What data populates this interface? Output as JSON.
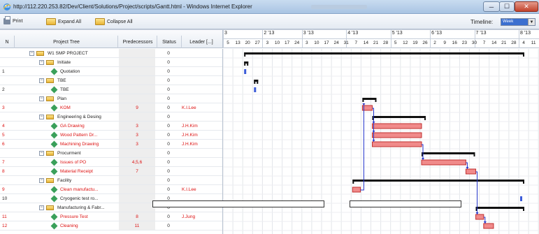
{
  "window": {
    "title": "http://112.220.253.82/Dev/Client/Solutions/Project/scripts/Gantt.html - Windows Internet Explorer",
    "minimize": "─",
    "maximize": "☐",
    "close": "✕"
  },
  "toolbar": {
    "print_label": "Print",
    "expand_label": "Expand All",
    "collapse_label": "Collapse All",
    "timeline_label": "Timeline:",
    "timeline_value": "Week",
    "timeline_arrow": "▼"
  },
  "columns": {
    "n": "N",
    "tree": "Project Tree",
    "pred": "Predecessors",
    "status": "Status",
    "leader": "Leader [...]"
  },
  "timeline": {
    "months": [
      "3",
      "2 '13",
      "3 '13",
      "4 '13",
      "5 '13",
      "6 '13",
      "7 '13",
      "8 '13"
    ],
    "weeks": [
      "5",
      "13",
      "20",
      "27",
      "3",
      "10",
      "17",
      "24",
      "3",
      "10",
      "17",
      "24",
      "31",
      "7",
      "14",
      "21",
      "28",
      "5",
      "12",
      "19",
      "26",
      "2",
      "9",
      "16",
      "23",
      "30",
      "7",
      "14",
      "21",
      "28",
      "4",
      "11"
    ]
  },
  "rows": [
    {
      "n": "",
      "name": "W1 SMP PROJECT",
      "level": 0,
      "type": "group",
      "pred": "",
      "status": "0",
      "lead": "",
      "red": false
    },
    {
      "n": "",
      "name": "Initiate",
      "level": 1,
      "type": "group",
      "pred": "",
      "status": "0",
      "lead": "",
      "red": false
    },
    {
      "n": "1",
      "name": "Quotation",
      "level": 2,
      "type": "task",
      "pred": "",
      "status": "0",
      "lead": "",
      "red": false
    },
    {
      "n": "",
      "name": "TBE",
      "level": 1,
      "type": "group",
      "pred": "",
      "status": "0",
      "lead": "",
      "red": false
    },
    {
      "n": "2",
      "name": "TBE",
      "level": 2,
      "type": "task",
      "pred": "",
      "status": "0",
      "lead": "",
      "red": false
    },
    {
      "n": "",
      "name": "Plan",
      "level": 1,
      "type": "group",
      "pred": "",
      "status": "0",
      "lead": "",
      "red": false
    },
    {
      "n": "3",
      "name": "KOM",
      "level": 2,
      "type": "task",
      "pred": "9",
      "status": "0",
      "lead": "K.I.Lee",
      "red": true
    },
    {
      "n": "",
      "name": "Engineering & Desing",
      "level": 1,
      "type": "group",
      "pred": "",
      "status": "0",
      "lead": "",
      "red": false
    },
    {
      "n": "4",
      "name": "GA Drawing",
      "level": 2,
      "type": "task",
      "pred": "3",
      "status": "0",
      "lead": "J.H.Kim",
      "red": true
    },
    {
      "n": "5",
      "name": "Wood Pattern Dr...",
      "level": 2,
      "type": "task",
      "pred": "3",
      "status": "0",
      "lead": "J.H.Kim",
      "red": true
    },
    {
      "n": "6",
      "name": "Machining Drawing",
      "level": 2,
      "type": "task",
      "pred": "3",
      "status": "0",
      "lead": "J.H.Kim",
      "red": true
    },
    {
      "n": "",
      "name": "Procurment",
      "level": 1,
      "type": "group",
      "pred": "",
      "status": "0",
      "lead": "",
      "red": false
    },
    {
      "n": "7",
      "name": "Issues of PO",
      "level": 2,
      "type": "task",
      "pred": "4,5,6",
      "status": "0",
      "lead": "",
      "red": true
    },
    {
      "n": "8",
      "name": "Material Receipt",
      "level": 2,
      "type": "task",
      "pred": "7",
      "status": "0",
      "lead": "",
      "red": true
    },
    {
      "n": "",
      "name": "Facility",
      "level": 1,
      "type": "group",
      "pred": "",
      "status": "0",
      "lead": "",
      "red": false
    },
    {
      "n": "9",
      "name": "Clean manufactu...",
      "level": 2,
      "type": "task",
      "pred": "",
      "status": "0",
      "lead": "K.I.Lee",
      "red": true
    },
    {
      "n": "10",
      "name": "Cryogenic test ro...",
      "level": 2,
      "type": "task",
      "pred": "",
      "status": "0",
      "lead": "",
      "red": false
    },
    {
      "n": "",
      "name": "Manufacturing & Fabr...",
      "level": 1,
      "type": "group",
      "pred": "",
      "status": "0",
      "lead": "",
      "red": false
    },
    {
      "n": "11",
      "name": "Pressure Test",
      "level": 2,
      "type": "task",
      "pred": "8",
      "status": "0",
      "lead": "J.Jung",
      "red": true
    },
    {
      "n": "12",
      "name": "Cleaning",
      "level": 2,
      "type": "task",
      "pred": "11",
      "status": "0",
      "lead": "",
      "red": true
    }
  ],
  "gantt": [
    {
      "row": 0,
      "kind": "summary",
      "start": 2,
      "end": 30
    },
    {
      "row": 1,
      "kind": "summary",
      "start": 2,
      "end": 2
    },
    {
      "row": 2,
      "kind": "task",
      "start": 2,
      "end": 2,
      "critical": false
    },
    {
      "row": 3,
      "kind": "summary",
      "start": 3,
      "end": 3
    },
    {
      "row": 4,
      "kind": "task",
      "start": 3,
      "end": 3,
      "critical": false
    },
    {
      "row": 5,
      "kind": "summary",
      "start": 14,
      "end": 15
    },
    {
      "row": 6,
      "kind": "task",
      "start": 14,
      "end": 15,
      "critical": true
    },
    {
      "row": 7,
      "kind": "summary",
      "start": 15,
      "end": 20
    },
    {
      "row": 8,
      "kind": "task",
      "start": 15,
      "end": 20,
      "critical": true
    },
    {
      "row": 9,
      "kind": "task",
      "start": 15,
      "end": 20,
      "critical": true
    },
    {
      "row": 10,
      "kind": "task",
      "start": 15,
      "end": 20,
      "critical": true
    },
    {
      "row": 11,
      "kind": "summary",
      "start": 20,
      "end": 25
    },
    {
      "row": 12,
      "kind": "task",
      "start": 20,
      "end": 24.5,
      "critical": true
    },
    {
      "row": 13,
      "kind": "task",
      "start": 24.5,
      "end": 25.5,
      "critical": true
    },
    {
      "row": 14,
      "kind": "summary",
      "start": 13,
      "end": 30
    },
    {
      "row": 15,
      "kind": "task",
      "start": 13,
      "end": 13.8,
      "critical": true
    },
    {
      "row": 16,
      "kind": "task",
      "start": 30,
      "end": 30,
      "critical": false
    },
    {
      "row": 17,
      "kind": "summary",
      "start": 25.5,
      "end": 30
    },
    {
      "row": 18,
      "kind": "task",
      "start": 25.5,
      "end": 26.3,
      "critical": true
    },
    {
      "row": 19,
      "kind": "task",
      "start": 26.3,
      "end": 27.3,
      "critical": true
    }
  ]
}
